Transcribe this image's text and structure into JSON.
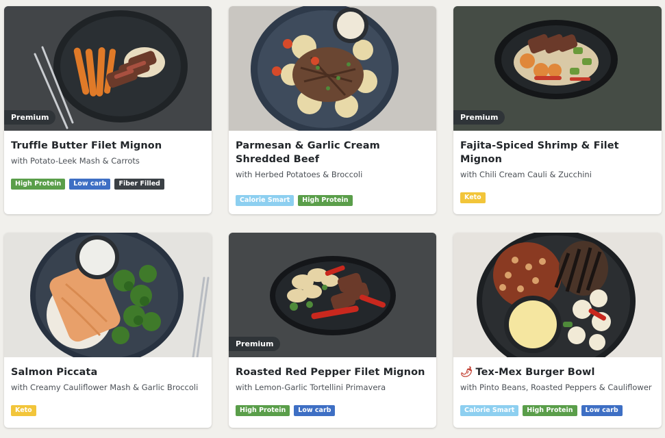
{
  "colors": {
    "High Protein": "#5a9e4a",
    "Low carb": "#3e6fc4",
    "Fiber Filled": "#3b4045",
    "Calorie Smart": "#8dcff0",
    "Keto": "#f2c53a",
    "premium_badge": "#2f3438"
  },
  "meals": [
    {
      "title": "Truffle Butter Filet Mignon",
      "subtitle": "with Potato-Leek Mash & Carrots",
      "premium": "Premium",
      "tags": [
        "High Protein",
        "Low carb",
        "Fiber Filled"
      ]
    },
    {
      "title": "Parmesan & Garlic Cream Shredded Beef",
      "subtitle": "with Herbed Potatoes & Broccoli",
      "premium": "",
      "tags": [
        "Calorie Smart",
        "High Protein"
      ]
    },
    {
      "title": "Fajita-Spiced Shrimp & Filet Mignon",
      "subtitle": "with Chili Cream Cauli & Zucchini",
      "premium": "Premium",
      "tags": [
        "Keto"
      ]
    },
    {
      "title": "Salmon Piccata",
      "subtitle": "with Creamy Cauliflower Mash & Garlic Broccoli",
      "premium": "",
      "tags": [
        "Keto"
      ]
    },
    {
      "title": "Roasted Red Pepper Filet Mignon",
      "subtitle": "with Lemon-Garlic Tortellini Primavera",
      "premium": "Premium",
      "tags": [
        "High Protein",
        "Low carb"
      ]
    },
    {
      "title": "Tex-Mex Burger Bowl",
      "subtitle": "with Pinto Beans, Roasted Peppers & Cauliflower",
      "premium": "",
      "spicy_icon": "chili-pepper-icon",
      "tags": [
        "Calorie Smart",
        "High Protein",
        "Low carb"
      ]
    }
  ]
}
